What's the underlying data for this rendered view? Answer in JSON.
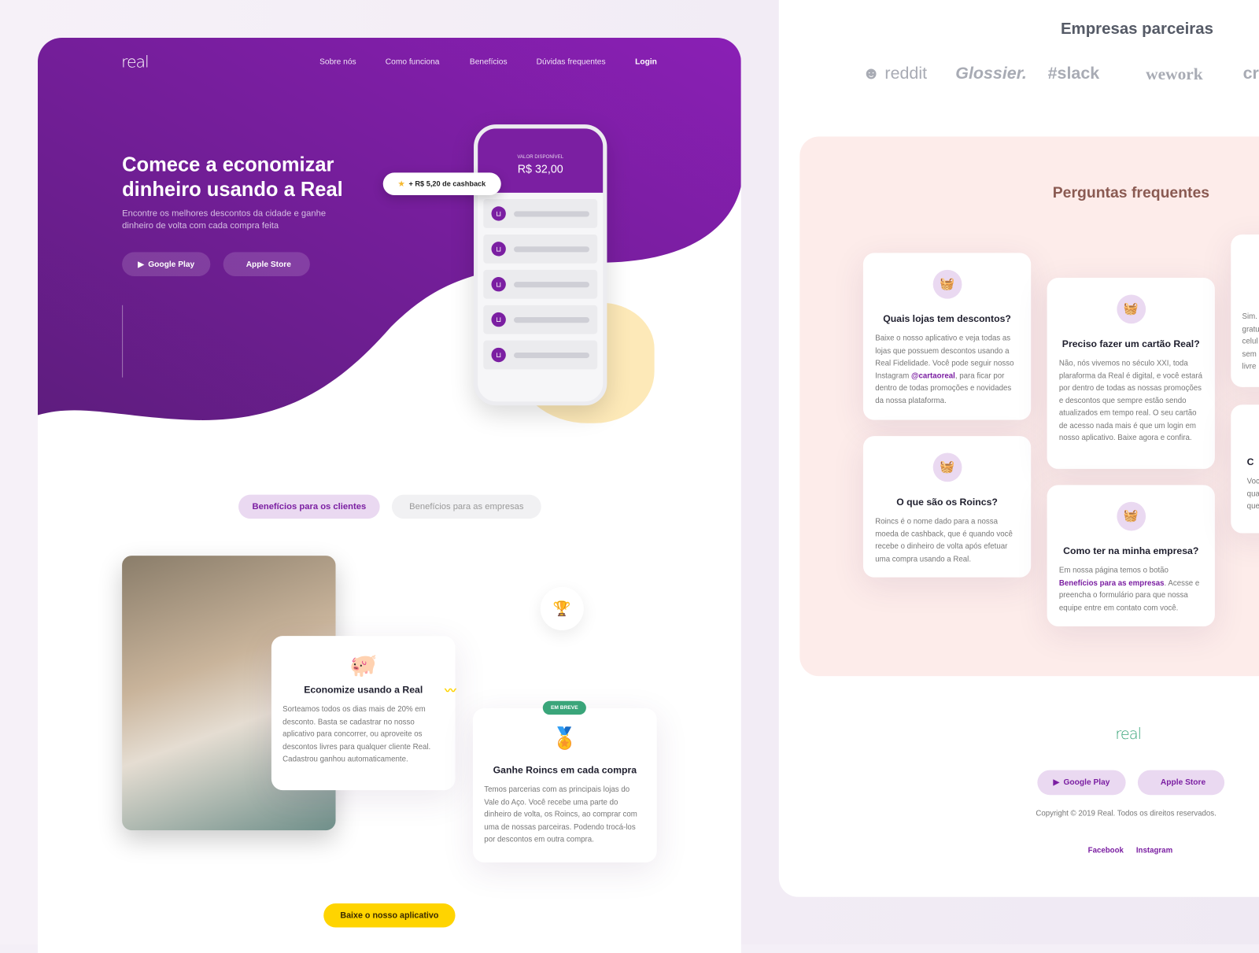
{
  "colors": {
    "brand_purple": "#7b1fa2",
    "accent_yellow": "#ffd400",
    "green": "#3aa57a",
    "faq_bg": "#fdecea"
  },
  "header": {
    "logo": "real",
    "nav": [
      "Sobre nós",
      "Como funciona",
      "Benefícios",
      "Dúvidas frequentes",
      "Login"
    ]
  },
  "hero": {
    "title": "Comece a economizar dinheiro usando a Real",
    "subtitle": "Encontre os melhores descontos da cidade e ganhe dinheiro de volta com cada compra feita",
    "google_play": "Google Play",
    "apple_store": "Apple Store",
    "phone": {
      "balance_label": "VALOR DISPONÍVEL",
      "balance": "R$ 32,00"
    },
    "cashback_toast": "+ R$ 5,20 de cashback"
  },
  "benefits": {
    "tabs": [
      {
        "label": "Benefícios para os clientes",
        "active": true
      },
      {
        "label": "Benefícios para as empresas",
        "active": false
      }
    ],
    "cards": [
      {
        "title": "Economize usando a Real",
        "text": "Sorteamos todos os dias mais de 20% em desconto. Basta se cadastrar no nosso aplicativo para concorrer, ou aproveite os descontos livres para qualquer cliente Real. Cadastrou ganhou automaticamente.",
        "icon": "piggy-bank-icon"
      },
      {
        "badge": "EM BREVE",
        "title": "Ganhe Roincs em cada compra",
        "text": "Temos parcerias com as principais lojas do Vale do Aço. Você recebe uma parte do dinheiro de volta, os Roincs, ao comprar com uma de nossas parceiras. Podendo trocá-los por descontos em outra compra.",
        "icon": "medal-icon"
      }
    ],
    "cta": "Baixe o nosso aplicativo"
  },
  "partners": {
    "title": "Empresas parceiras",
    "logos": [
      "reddit",
      "Glossier.",
      "slack",
      "wework",
      "cr"
    ]
  },
  "faq": {
    "title": "Perguntas frequentes",
    "items": [
      {
        "q": "Quais lojas tem descontos?",
        "a1": "Baixe o nosso aplicativo e veja todas as lojas que possuem descontos usando a Real Fidelidade. Você pode seguir nosso Instagram ",
        "link": "@cartaoreal",
        "a2": ", para ficar por dentro de todas promoções e novidades da nossa plataforma."
      },
      {
        "q": "O que são os Roincs?",
        "a1": "Roincs é o nome dado para a nossa moeda de cashback, que é quando você recebe o dinheiro de volta após efetuar uma compra usando a Real."
      },
      {
        "q": "Preciso fazer um cartão Real?",
        "a1": "Não, nós vivemos no século XXI, toda plaraforma da Real é digital, e você estará por dentro de todas as nossas promoções e descontos que sempre estão sendo atualizados em tempo real. O seu cartão de acesso nada mais é que um login em nosso aplicativo. Baixe agora e confira."
      },
      {
        "q": "Como ter na minha empresa?",
        "a1": "Em nossa página temos o botão ",
        "link": "Benefícios para as empresas",
        "a2": ". Acesse e preencha o formulário para que nossa equipe entre em contato com você."
      },
      {
        "a1": "Sim. gratu celul sem livre"
      },
      {
        "q": "C",
        "a1": "Você qual que"
      }
    ]
  },
  "footer": {
    "logo": "real",
    "google_play": "Google Play",
    "apple_store": "Apple Store",
    "copyright": "Copyright © 2019 Real. Todos os direitos reservados.",
    "links": [
      "Facebook",
      "Instagram"
    ]
  }
}
